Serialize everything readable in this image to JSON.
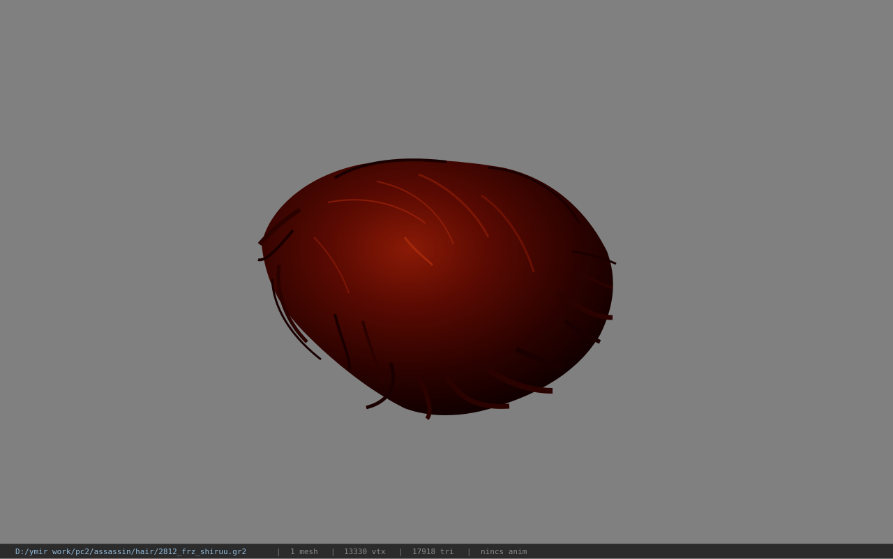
{
  "viewer": {
    "background_color": "#808080",
    "model_icon": "hair-mesh-model",
    "model_colors": {
      "dark": "#1a0000",
      "mid": "#5a0a02",
      "highlight": "#b02a0c"
    }
  },
  "statusbar": {
    "path": "D:/ymir work/pc2/assassin/hair/2812_frz_shiruu.gr2",
    "separator": "|",
    "mesh_count": "1 mesh",
    "vertex_count": "13330 vtx",
    "triangle_count": "17918 tri",
    "anim_status": "nincs anim"
  }
}
